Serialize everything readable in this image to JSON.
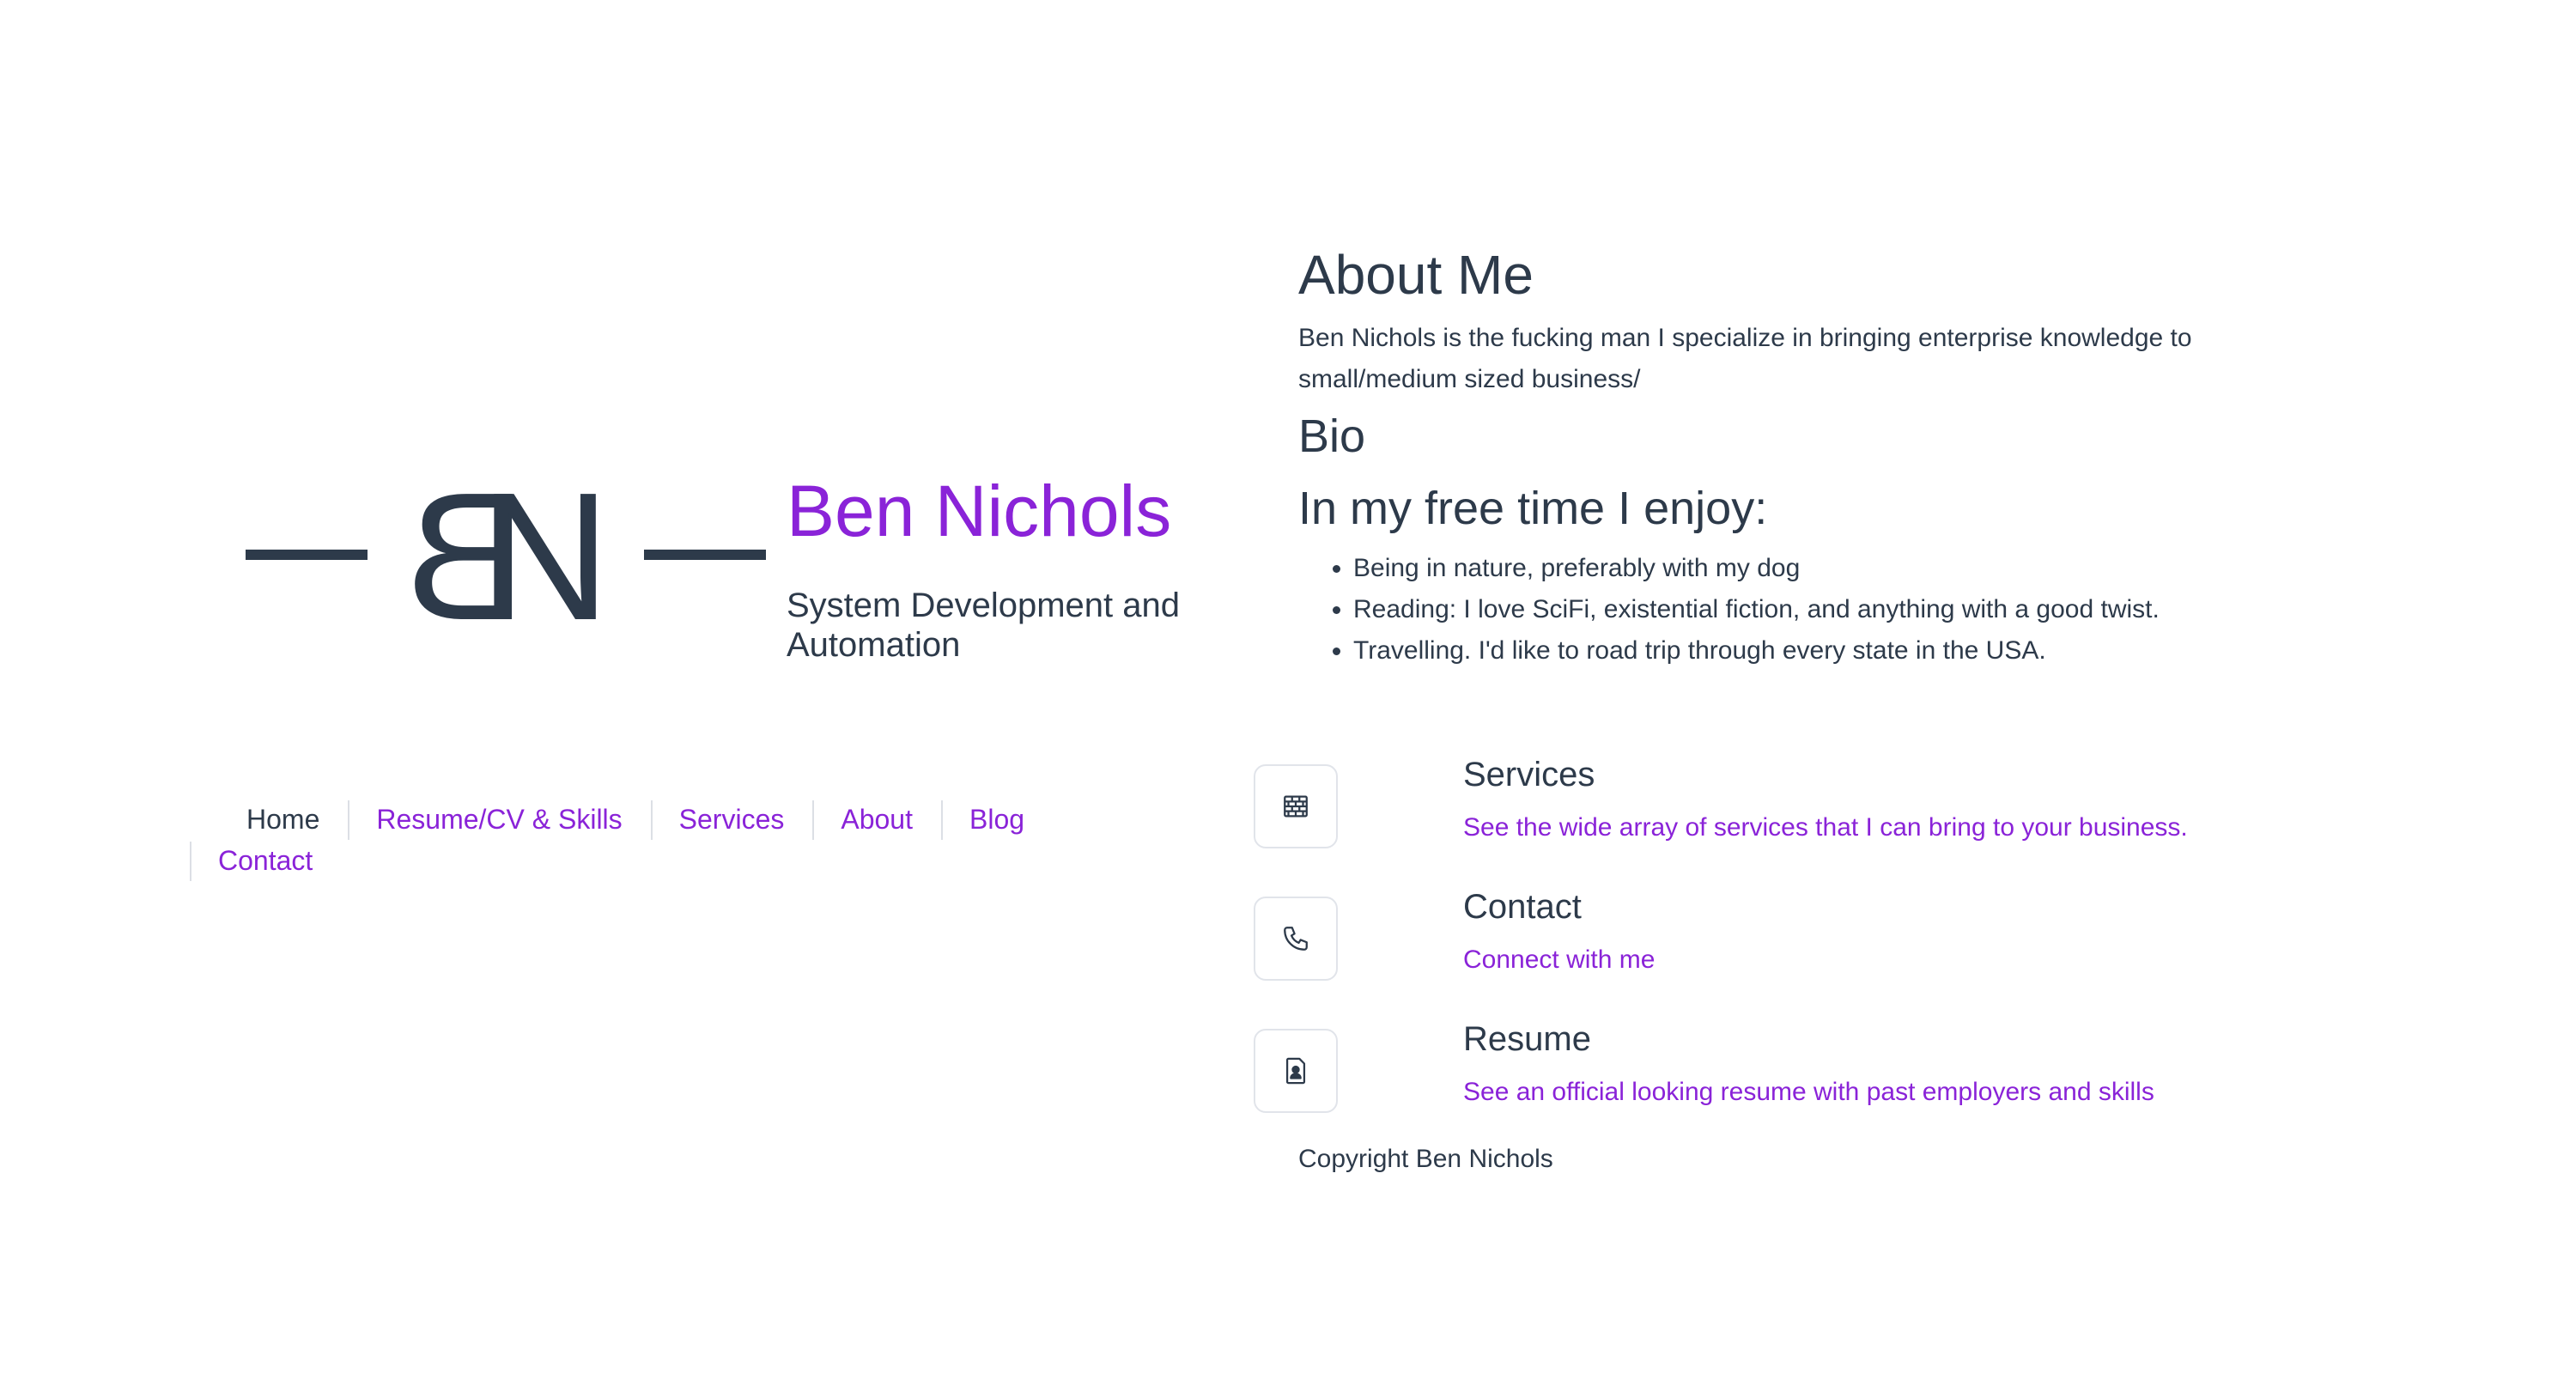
{
  "brand": {
    "monogram_left": "B",
    "monogram_right": "N",
    "name": "Ben Nichols",
    "tagline": "System Development and Automation",
    "name_color": "#8a23d8",
    "text_color": "#2d3a4a"
  },
  "nav": {
    "items": [
      {
        "label": "Home",
        "active": true
      },
      {
        "label": "Resume/CV & Skills",
        "active": false
      },
      {
        "label": "Services",
        "active": false
      },
      {
        "label": "About",
        "active": false
      },
      {
        "label": "Blog",
        "active": false
      },
      {
        "label": "Contact",
        "active": false
      }
    ]
  },
  "about": {
    "title": "About Me",
    "intro": "Ben Nichols is the fucking man I specialize in bringing enterprise knowledge to small/medium sized business/",
    "bio_heading": "Bio",
    "enjoy_heading": "In my free time I enjoy:",
    "enjoy_items": [
      "Being in nature, preferably with my dog",
      "Reading: I love SciFi, existential fiction, and anything with a good twist.",
      "Travelling. I'd like to road trip through every state in the USA."
    ]
  },
  "cards": [
    {
      "icon": "brick-wall-icon",
      "title": "Services",
      "link": "See the wide array of services that I can bring to your business."
    },
    {
      "icon": "phone-icon",
      "title": "Contact",
      "link": "Connect with me"
    },
    {
      "icon": "resume-file-icon",
      "title": "Resume",
      "link": "See an official looking resume with past employers and skills"
    }
  ],
  "footer": {
    "copyright": "Copyright Ben Nichols"
  },
  "colors": {
    "accent": "#8a23d8",
    "text": "#2d3a4a",
    "border": "#e1e4ea"
  }
}
